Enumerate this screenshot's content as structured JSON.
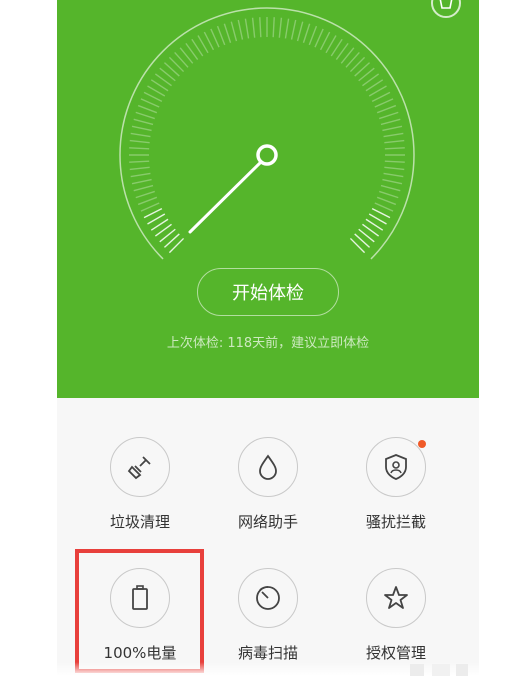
{
  "header": {
    "settings_icon": "settings-icon",
    "theme_color": "#55b52b"
  },
  "main": {
    "check_button": "开始体检",
    "last_check": "上次体检: 118天前，建议立即体检"
  },
  "tools": [
    {
      "label": "垃圾清理",
      "icon": "broom-icon"
    },
    {
      "label": "网络助手",
      "icon": "drop-icon"
    },
    {
      "label": "骚扰拦截",
      "icon": "shield-user-icon",
      "badge": true,
      "badge_color": "#f05a28"
    },
    {
      "label": "100%电量",
      "icon": "battery-icon"
    },
    {
      "label": "病毒扫描",
      "icon": "scan-icon"
    },
    {
      "label": "授权管理",
      "icon": "star-icon"
    }
  ],
  "annotation": {
    "highlight_color": "#e8403c"
  }
}
